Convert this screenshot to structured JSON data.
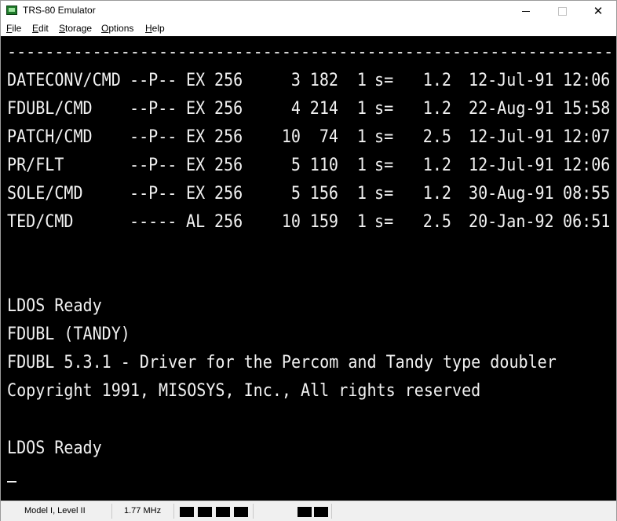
{
  "window": {
    "title": "TRS-80 Emulator",
    "minimize_label": "—",
    "close_label": "✕"
  },
  "menu": {
    "items": [
      {
        "label": "File",
        "underline": "F"
      },
      {
        "label": "Edit",
        "underline": "E"
      },
      {
        "label": "Storage",
        "underline": "S"
      },
      {
        "label": "Options",
        "underline": "O"
      },
      {
        "label": "Help",
        "underline": "H"
      }
    ]
  },
  "screen": {
    "rule_line": "----------------------------------------------------------------",
    "directory": [
      {
        "name": "DATECONV/CMD",
        "attr": "--P--",
        "type": "EX",
        "lrl": "256",
        "a": "3",
        "b": "182",
        "c": "1",
        "d": "s=",
        "ver": "1.2",
        "date": "12-Jul-91",
        "time": "12:06"
      },
      {
        "name": "FDUBL/CMD",
        "attr": "--P--",
        "type": "EX",
        "lrl": "256",
        "a": "4",
        "b": "214",
        "c": "1",
        "d": "s=",
        "ver": "1.2",
        "date": "22-Aug-91",
        "time": "15:58"
      },
      {
        "name": "PATCH/CMD",
        "attr": "--P--",
        "type": "EX",
        "lrl": "256",
        "a": "10",
        "b": "74",
        "c": "1",
        "d": "s=",
        "ver": "2.5",
        "date": "12-Jul-91",
        "time": "12:07"
      },
      {
        "name": "PR/FLT",
        "attr": "--P--",
        "type": "EX",
        "lrl": "256",
        "a": "5",
        "b": "110",
        "c": "1",
        "d": "s=",
        "ver": "1.2",
        "date": "12-Jul-91",
        "time": "12:06"
      },
      {
        "name": "SOLE/CMD",
        "attr": "--P--",
        "type": "EX",
        "lrl": "256",
        "a": "5",
        "b": "156",
        "c": "1",
        "d": "s=",
        "ver": "1.2",
        "date": "30-Aug-91",
        "time": "08:55"
      },
      {
        "name": "TED/CMD",
        "attr": "-----",
        "type": "AL",
        "lrl": "256",
        "a": "10",
        "b": "159",
        "c": "1",
        "d": "s=",
        "ver": "2.5",
        "date": "20-Jan-92",
        "time": "06:51"
      }
    ],
    "lines": [
      "LDOS Ready",
      "FDUBL (TANDY)",
      "FDUBL 5.3.1 - Driver for the Percom and Tandy type doubler",
      "Copyright 1991, MISOSYS, Inc., All rights reserved",
      "LDOS Ready"
    ],
    "cursor": "_"
  },
  "status": {
    "model": "Model I, Level II",
    "clock": "1.77 MHz"
  }
}
